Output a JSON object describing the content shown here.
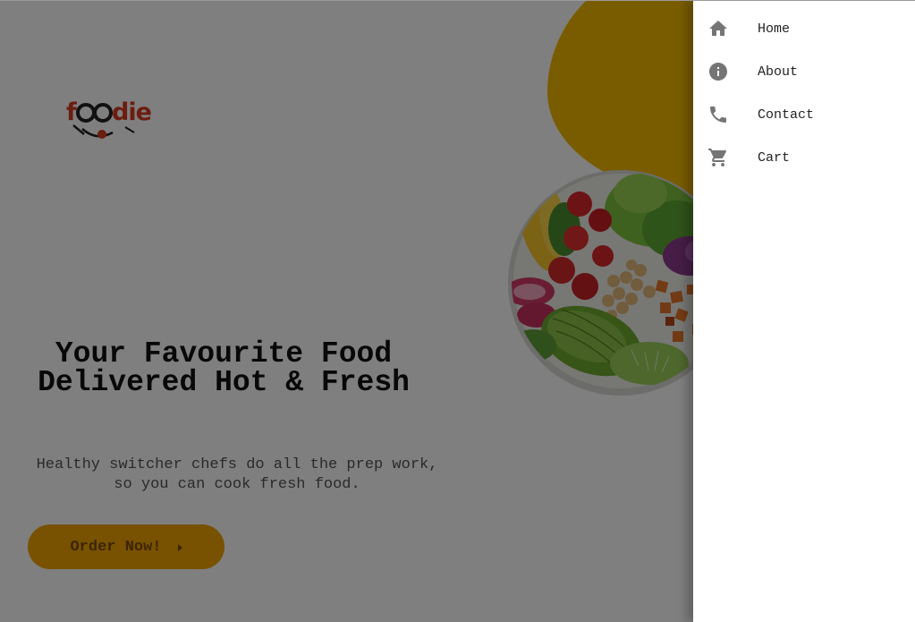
{
  "brand": {
    "logo_text": "foodie",
    "accent_color": "#f5b800",
    "button_color": "#f0a500",
    "logo_red": "#d63a1e"
  },
  "hero": {
    "headline": "Your Favourite Food Delivered Hot & Fresh",
    "subtext": "Healthy switcher chefs do all the prep work, so you can cook fresh food.",
    "cta_label": "Order Now!",
    "image_alt": "salad bowl"
  },
  "drawer": {
    "items": [
      {
        "label": "Home",
        "icon": "home-icon"
      },
      {
        "label": "About",
        "icon": "info-icon"
      },
      {
        "label": "Contact",
        "icon": "phone-icon"
      },
      {
        "label": "Cart",
        "icon": "cart-icon"
      }
    ]
  },
  "overlay": {
    "scrim_color": "rgba(0,0,0,0.5)"
  }
}
